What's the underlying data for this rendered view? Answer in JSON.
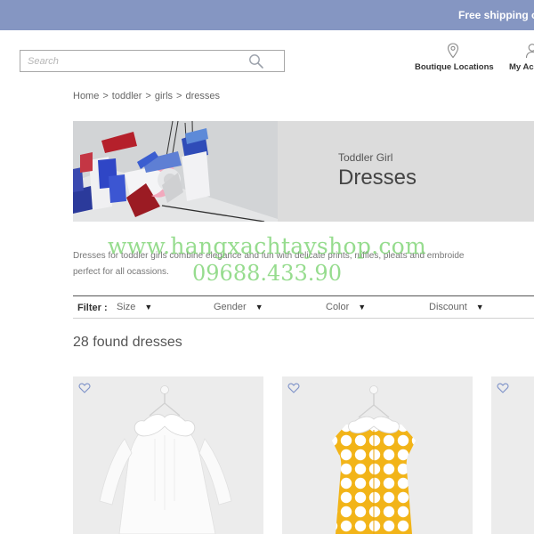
{
  "promo": {
    "text": "Free shipping o"
  },
  "search": {
    "placeholder": "Search"
  },
  "nav": {
    "locations_label": "Boutique Locations",
    "account_label": "My Ac"
  },
  "breadcrumb": {
    "home": "Home",
    "separator": ">",
    "toddler": "toddler",
    "girls": "girls",
    "dresses": "dresses"
  },
  "banner": {
    "subtitle": "Toddler Girl",
    "title": "Dresses"
  },
  "description": {
    "line1": "Dresses for toddler girls combine elegance and fun with delicate prints, ruffles, pleats and embroide",
    "line2": "perfect for all ocassions."
  },
  "filter": {
    "label": "Filter :",
    "options": [
      "Size",
      "Gender",
      "Color",
      "Discount"
    ],
    "caret": "▼"
  },
  "results": {
    "count_text": "28 found dresses"
  },
  "watermark": {
    "site": "www.hangxachtayshop.com",
    "phone": "09688.433.90"
  },
  "colors": {
    "topbar": "#8596c2",
    "heart": "#7f93c9",
    "dot_dress": "#f2b418"
  },
  "icons": [
    "search-icon",
    "location-pin-icon",
    "user-icon",
    "heart-icon",
    "caret-down-icon"
  ]
}
